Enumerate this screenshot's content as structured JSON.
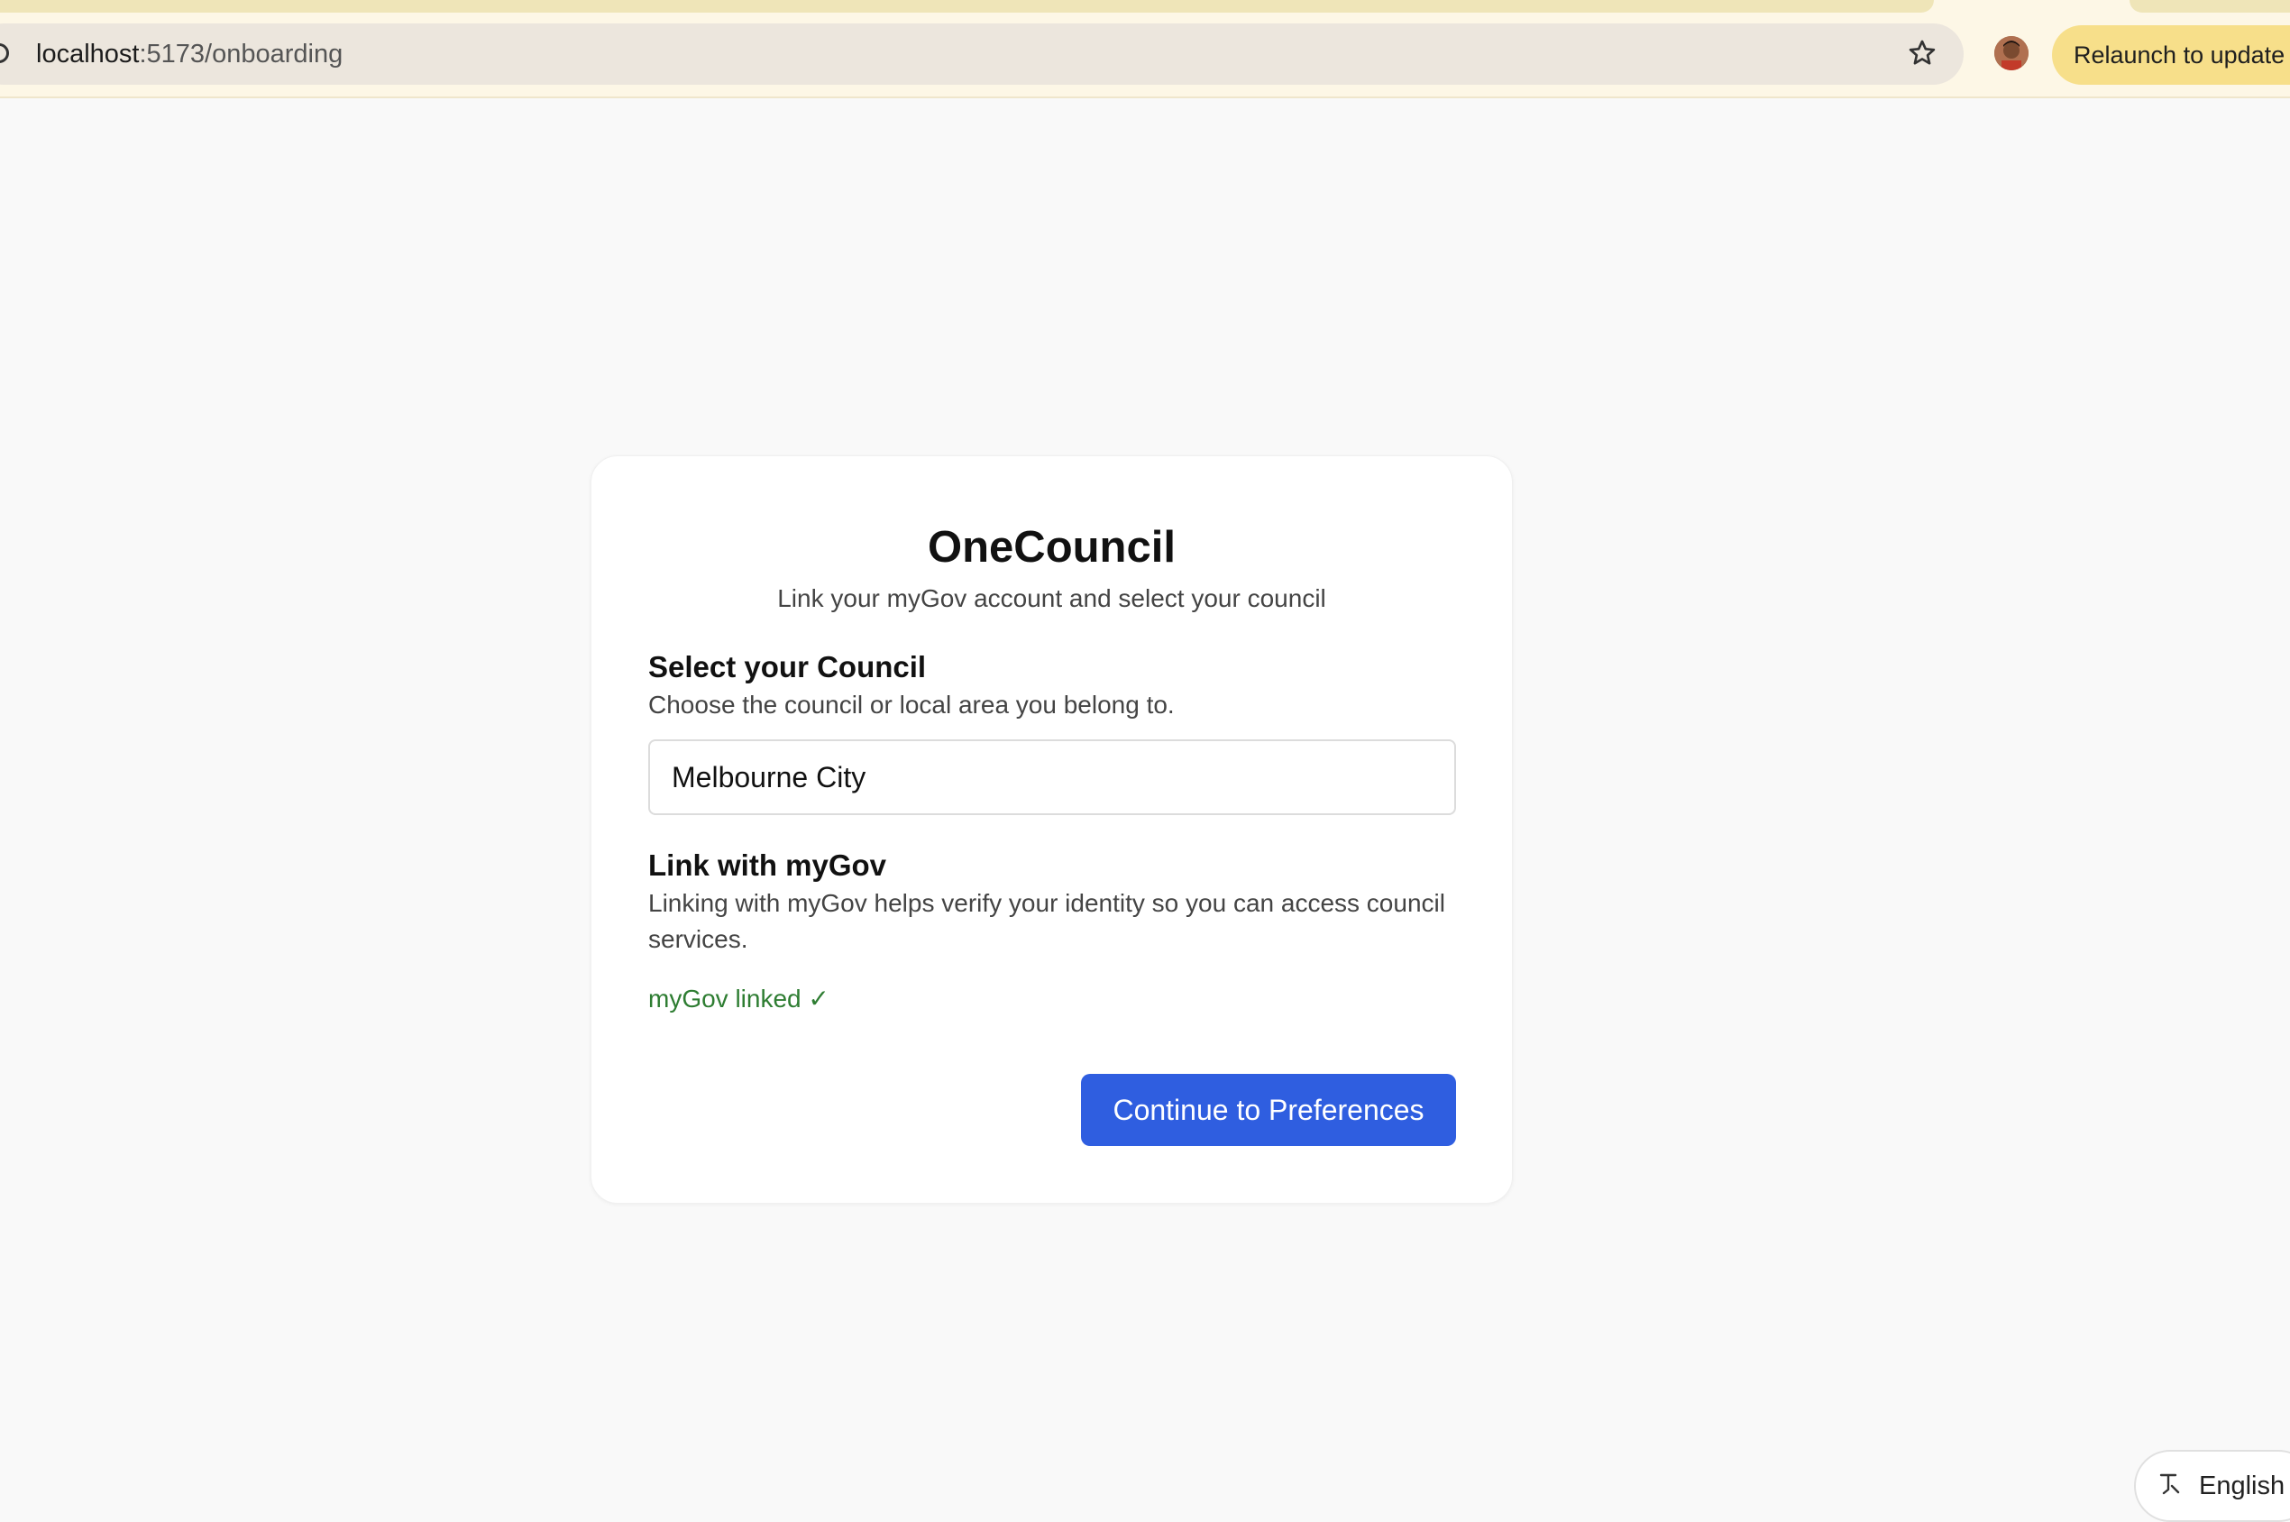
{
  "browser": {
    "url_host": "localhost",
    "url_path": ":5173/onboarding",
    "relaunch_label": "Relaunch to update"
  },
  "card": {
    "title": "OneCouncil",
    "subtitle": "Link your myGov account and select your council",
    "council_section": {
      "heading": "Select your Council",
      "description": "Choose the council or local area you belong to.",
      "input_value": "Melbourne City"
    },
    "mygov_section": {
      "heading": "Link with myGov",
      "description": "Linking with myGov helps verify your identity so you can access council services.",
      "status": "myGov linked ✓"
    },
    "continue_label": "Continue to Preferences"
  },
  "language": {
    "label": "English"
  },
  "colors": {
    "primary": "#2f5ee0",
    "success": "#2e7d32",
    "relaunch_bg": "#f7df8a"
  }
}
